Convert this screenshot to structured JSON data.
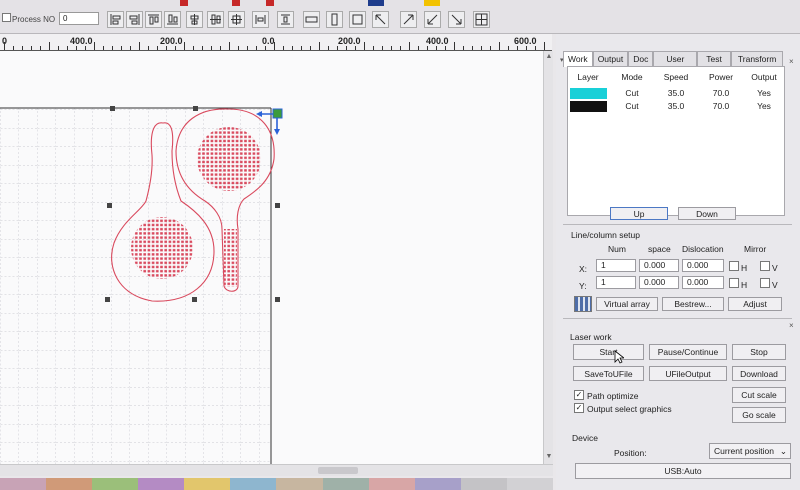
{
  "toolbar": {
    "process_label": "Process NO",
    "process_value": "0",
    "buttons": [
      "align-left-icon",
      "align-right-icon",
      "align-top-icon",
      "align-bottom-icon",
      "center-horizontal-icon",
      "center-vertical-icon",
      "align-center-icon",
      "distribute-horizontal-icon",
      "distribute-vertical-icon",
      "same-width-icon",
      "same-height-icon",
      "same-size-icon",
      "arrange-top-left-icon",
      "arrange-top-right-icon",
      "arrange-bottom-left-icon",
      "arrange-bottom-right-icon",
      "grid-icon"
    ]
  },
  "ruler": {
    "labels": [
      "0",
      "400.0",
      "200.0",
      "0.0",
      "200.0",
      "400.0",
      "600.0"
    ]
  },
  "tabs": [
    "Work",
    "Output",
    "Doc",
    "User",
    "Test",
    "Transform"
  ],
  "layers": {
    "headers": [
      "Layer",
      "Mode",
      "Speed",
      "Power",
      "Output"
    ],
    "rows": [
      {
        "color": "#19d0d8",
        "mode": "Cut",
        "speed": "35.0",
        "power": "70.0",
        "output": "Yes"
      },
      {
        "color": "#111111",
        "mode": "Cut",
        "speed": "35.0",
        "power": "70.0",
        "output": "Yes"
      }
    ],
    "up_label": "Up",
    "down_label": "Down"
  },
  "line_column": {
    "title": "Line/column setup",
    "headers": {
      "num": "Num",
      "space": "space",
      "dislocation": "Dislocation",
      "mirror": "Mirror"
    },
    "x": {
      "label": "X:",
      "num": "1",
      "space": "0.000",
      "dislocation": "0.000",
      "h": "H",
      "v": "V"
    },
    "y": {
      "label": "Y:",
      "num": "1",
      "space": "0.000",
      "dislocation": "0.000",
      "h": "H",
      "v": "V"
    },
    "virtual_array": "Virtual array",
    "bestrew": "Bestrew...",
    "adjust": "Adjust"
  },
  "laser_work": {
    "title": "Laser work",
    "start": "Start",
    "pause": "Pause/Continue",
    "stop": "Stop",
    "save_to_ufile": "SaveToUFile",
    "ufile_output": "UFileOutput",
    "download": "Download",
    "path_optimize": "Path optimize",
    "output_select": "Output select graphics",
    "cut_scale": "Cut scale",
    "go_scale": "Go scale"
  },
  "device": {
    "title": "Device",
    "position_label": "Position:",
    "position_value": "Current position",
    "usb": "USB:Auto"
  },
  "colors": {
    "design": "#d94a5e",
    "handle": "#2a62d8",
    "palette": [
      "#c8a3b6",
      "#d09a78",
      "#9bbf7a",
      "#b48bc4",
      "#e2c66c",
      "#8eb6cf",
      "#c7b6a0",
      "#9fb1a8",
      "#d8a6a6",
      "#a7a0c9",
      "#c4c3c6",
      "#d2d1d4"
    ]
  }
}
